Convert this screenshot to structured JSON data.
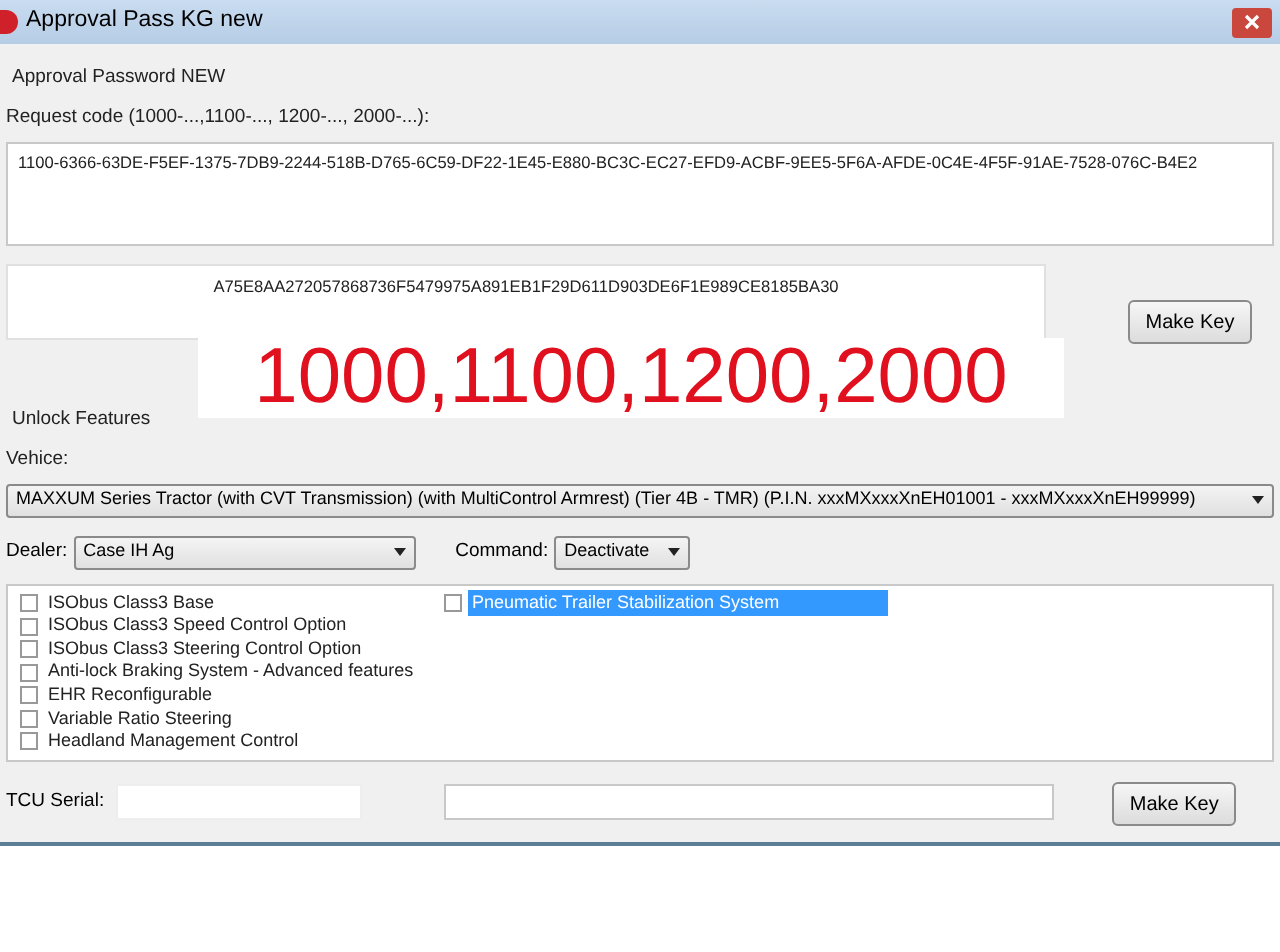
{
  "window": {
    "title": "Approval Pass KG new"
  },
  "group_title": "Approval Password NEW",
  "request_label": "Request code (1000-...,1100-..., 1200-..., 2000-...):",
  "request_code": "1100-6366-63DE-F5EF-1375-7DB9-2244-518B-D765-6C59-DF22-1E45-E880-BC3C-EC27-EFD9-ACBF-9EE5-5F6A-AFDE-0C4E-4F5F-91AE-7528-076C-B4E2",
  "key_output": "A75E8AA272057868736F5479975A891EB1F29D611D903DE6F1E989CE8185BA30",
  "make_key_button": "Make Key",
  "overlay_caption": "1000,1100,1200,2000",
  "unlock_title": "Unlock Features",
  "vehicle_label": "Vehice:",
  "vehicle_value": "MAXXUM Series Tractor (with CVT Transmission) (with MultiControl Armrest) (Tier 4B - TMR) (P.I.N. xxxMXxxxXnEH01001 - xxxMXxxxXnEH99999)",
  "dealer_label": "Dealer:",
  "dealer_value": "Case IH Ag",
  "command_label": "Command:",
  "command_value": "Deactivate",
  "features": [
    {
      "label": "ISObus Class3 Base",
      "checked": false,
      "selected": false
    },
    {
      "label": "ISObus Class3 Speed Control Option",
      "checked": false,
      "selected": false
    },
    {
      "label": "ISObus Class3 Steering Control Option",
      "checked": false,
      "selected": false
    },
    {
      "label": "Anti-lock Braking System - Advanced features",
      "checked": false,
      "selected": false
    },
    {
      "label": "EHR Reconfigurable",
      "checked": false,
      "selected": false
    },
    {
      "label": "Variable Ratio Steering",
      "checked": false,
      "selected": false
    },
    {
      "label": "Headland Management Control",
      "checked": false,
      "selected": false
    },
    {
      "label": "Pneumatic Trailer Stabilization System",
      "checked": false,
      "selected": true
    }
  ],
  "tcu_label": "TCU Serial:",
  "tcu_make_key_button": "Make Key"
}
